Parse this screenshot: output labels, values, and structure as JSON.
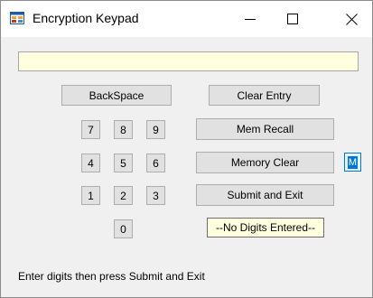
{
  "window": {
    "title": "Encryption Keypad",
    "icons": {
      "app": "app-icon",
      "minimize": "minimize-icon",
      "maximize": "maximize-icon",
      "close": "close-icon"
    }
  },
  "display": {
    "value": ""
  },
  "buttons": {
    "backspace": "BackSpace",
    "clear_entry": "Clear Entry",
    "mem_recall": "Mem Recall",
    "memory_clear": "Memory Clear",
    "submit_exit": "Submit and Exit",
    "memory_indicator": "M"
  },
  "digits": [
    "7",
    "8",
    "9",
    "4",
    "5",
    "6",
    "1",
    "2",
    "3",
    "0"
  ],
  "status": "--No Digits Entered--",
  "hint": "Enter digits then press Submit and Exit",
  "colors": {
    "display_bg": "#ffffe0",
    "button_bg": "#e1e1e1",
    "accent": "#0078d7"
  }
}
